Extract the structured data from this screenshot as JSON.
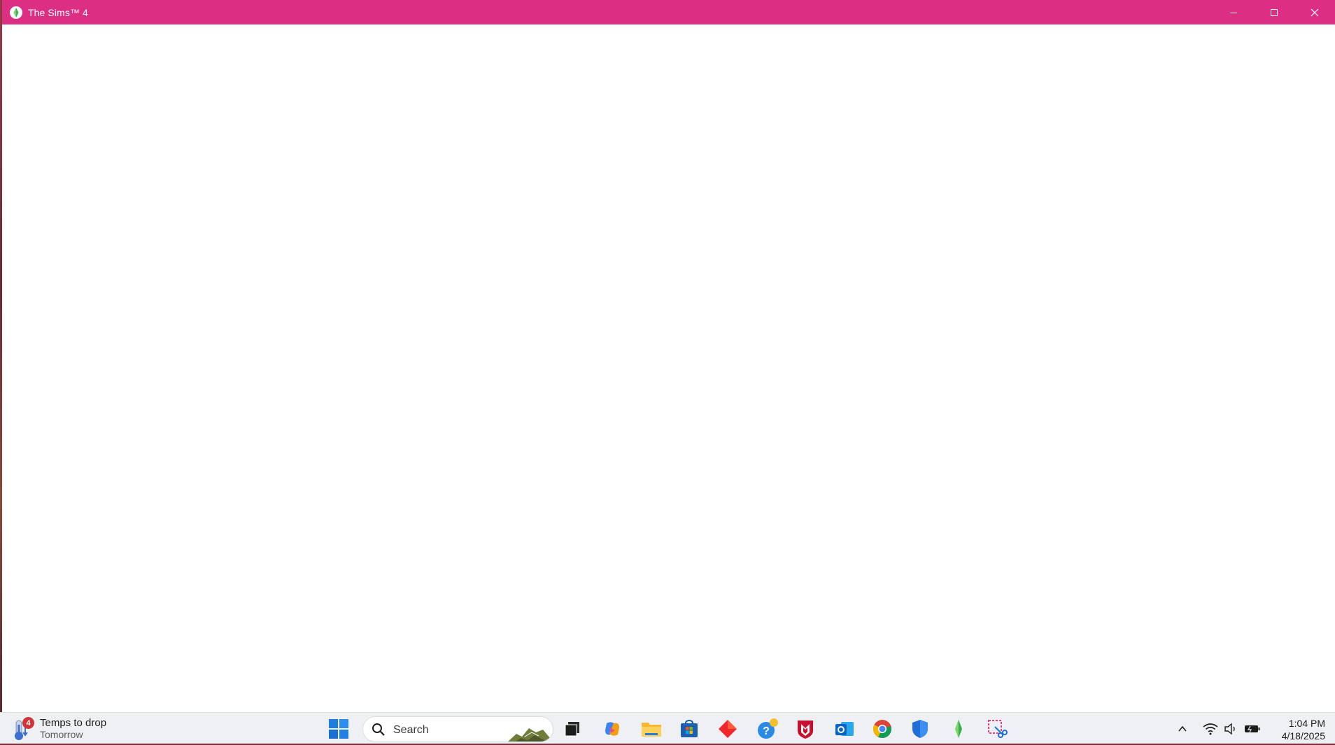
{
  "window": {
    "title": "The Sims™ 4",
    "title_bar_color": "#dc2f84",
    "app_icon": "sims-plumbob-icon",
    "controls": [
      "minimize-icon",
      "maximize-icon",
      "close-icon"
    ]
  },
  "taskbar": {
    "weather": {
      "badge_count": "4",
      "title": "Temps to drop",
      "subtitle": "Tomorrow",
      "icon": "thermometer-icon"
    },
    "start_icon": "windows-start-icon",
    "search": {
      "placeholder": "Search",
      "icon": "search-icon"
    },
    "pinned_apps": [
      "task-view-icon",
      "copilot-icon",
      "file-explorer-icon",
      "microsoft-store-icon",
      "diamond-app-icon",
      "help-app-icon",
      "mcafee-icon",
      "outlook-icon",
      "chrome-icon",
      "defender-shield-icon",
      "sims-app-icon",
      "snipping-tool-icon"
    ],
    "tray": {
      "icons": [
        "chevron-up-icon",
        "wifi-icon",
        "speaker-icon",
        "battery-icon"
      ],
      "time": "1:04 PM",
      "date": "4/18/2025"
    }
  }
}
